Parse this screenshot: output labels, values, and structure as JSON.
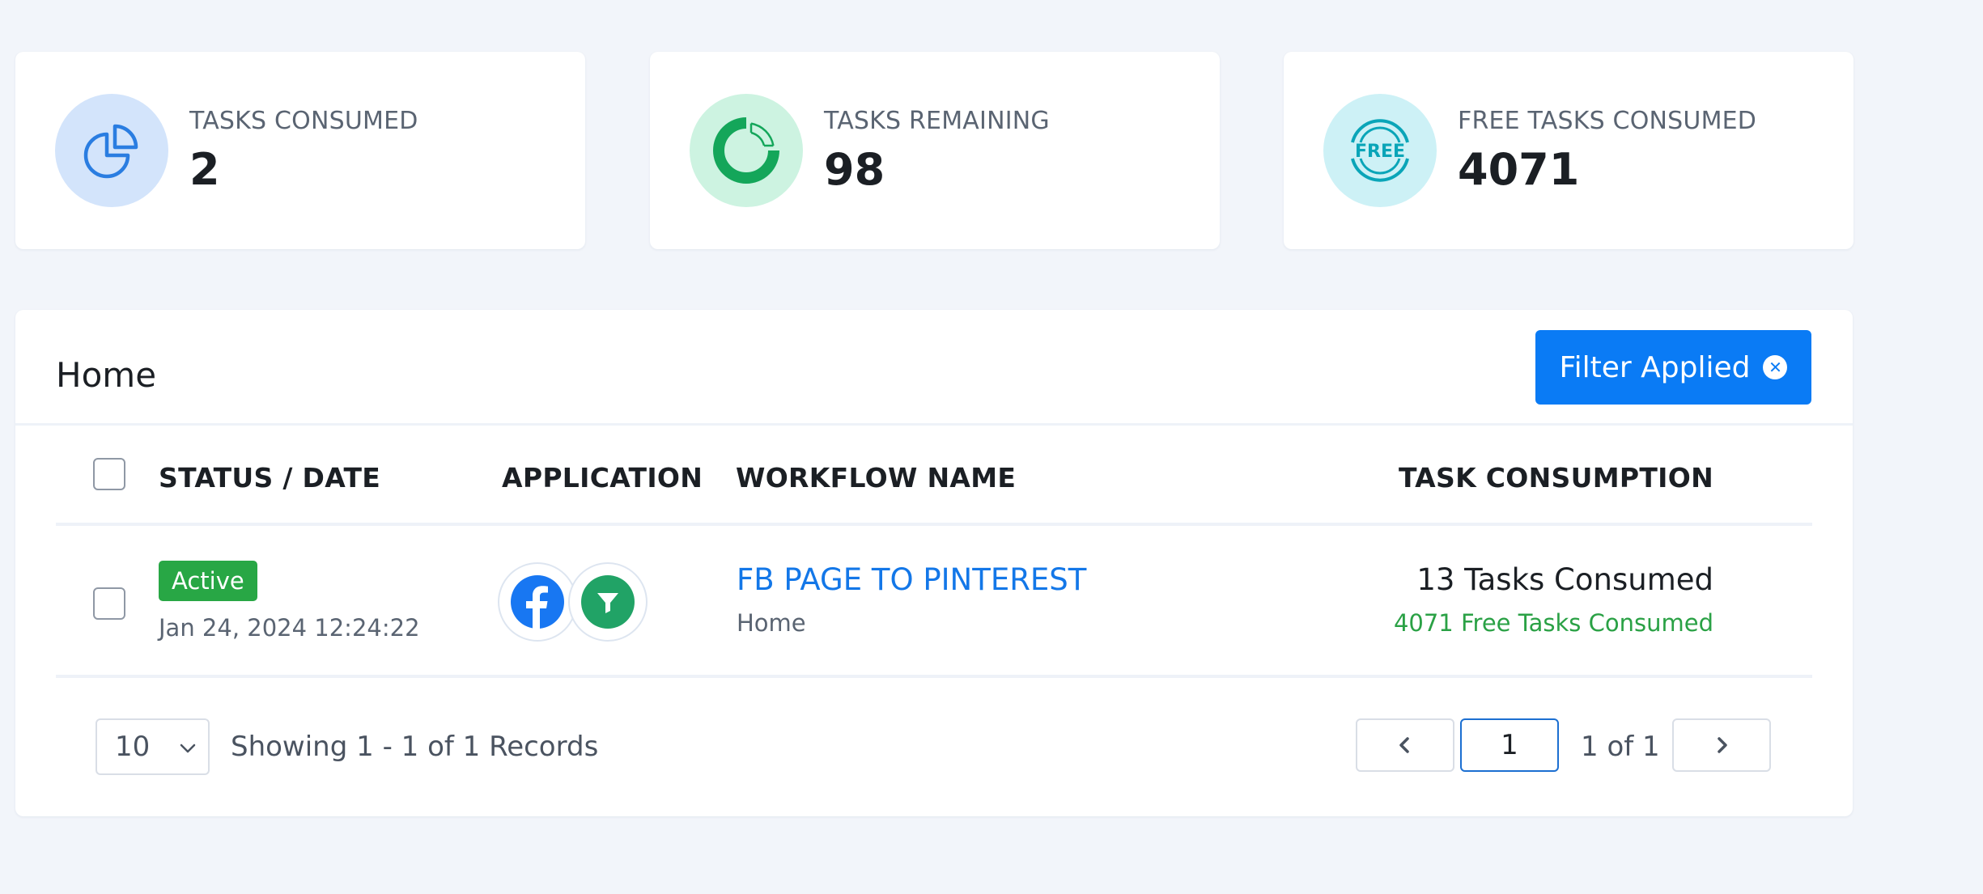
{
  "stats": [
    {
      "label": "TASKS CONSUMED",
      "value": "2",
      "icon": "pie-chart-icon",
      "icon_bg": "#d3e4fb",
      "icon_color": "#2a7de1"
    },
    {
      "label": "TASKS REMAINING",
      "value": "98",
      "icon": "donut-chart-icon",
      "icon_bg": "#cdf3e1",
      "icon_color": "#14a65a"
    },
    {
      "label": "FREE TASKS CONSUMED",
      "value": "4071",
      "icon": "free-badge-icon",
      "icon_bg": "#cdf1f6",
      "icon_color": "#0aa5b8",
      "icon_text": "FREE"
    }
  ],
  "panel": {
    "title": "Home",
    "filter_button": "Filter Applied"
  },
  "table": {
    "headers": {
      "status_date": "STATUS / DATE",
      "application": "APPLICATION",
      "workflow_name": "WORKFLOW NAME",
      "task_consumption": "TASK CONSUMPTION"
    },
    "rows": [
      {
        "status": "Active",
        "date": "Jan 24, 2024 12:24:22",
        "applications": [
          "facebook-icon",
          "filter-icon"
        ],
        "workflow_name": "FB PAGE TO PINTEREST",
        "workflow_folder": "Home",
        "tasks_consumed": "13 Tasks Consumed",
        "free_tasks_consumed": "4071 Free Tasks Consumed"
      }
    ]
  },
  "pagination": {
    "page_size": "10",
    "showing": "Showing 1 - 1 of 1 Records",
    "current_page": "1",
    "page_of": "1 of 1"
  },
  "colors": {
    "accent": "#0a7bf5",
    "link": "#1377e8",
    "active_badge": "#28a745",
    "free_text": "#2aa145",
    "background": "#f2f5fa"
  }
}
